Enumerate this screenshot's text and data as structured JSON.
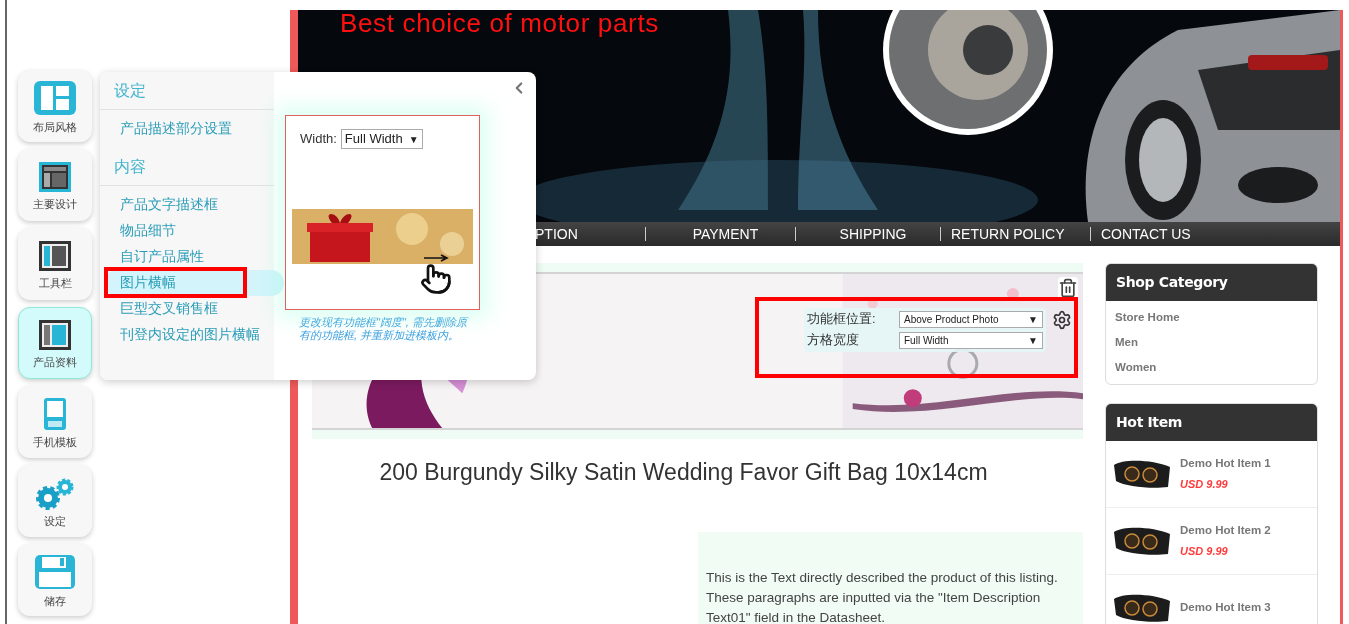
{
  "sidebar_tools": [
    {
      "kind": "layout",
      "label": "布局风格",
      "selected": false
    },
    {
      "kind": "design",
      "label": "主要设计",
      "selected": false
    },
    {
      "kind": "toolbar",
      "label": "工具栏",
      "selected": false
    },
    {
      "kind": "product",
      "label": "产品资料",
      "selected": true
    },
    {
      "kind": "mobile",
      "label": "手机模板",
      "selected": false
    },
    {
      "kind": "settings",
      "label": "设定",
      "selected": false
    },
    {
      "kind": "save",
      "label": "储存",
      "selected": false
    }
  ],
  "menu": {
    "sections": [
      {
        "heading": "设定",
        "items": [
          {
            "label": "产品描述部分设置",
            "selected": false
          }
        ]
      },
      {
        "heading": "内容",
        "items": [
          {
            "label": "产品文字描述框",
            "selected": false
          },
          {
            "label": "物品细节",
            "selected": false
          },
          {
            "label": "自订产品属性",
            "selected": false
          },
          {
            "label": "图片横幅",
            "selected": true
          },
          {
            "label": "巨型交叉销售框",
            "selected": false
          },
          {
            "label": "刊登内设定的图片横幅",
            "selected": false
          }
        ]
      }
    ]
  },
  "preview": {
    "width_label": "Width:",
    "width_value": "Full Width",
    "width_arrow": "▼",
    "note": "更改现有功能框\"阔度\", 需先删除原有的功能框, 并重新加进模板内。"
  },
  "banner": {
    "tagline": "Best choice of motor parts"
  },
  "nav": [
    "PTION",
    "PAYMENT",
    "SHIPPING",
    "RETURN POLICY",
    "CONTACT US"
  ],
  "module_settings": [
    {
      "label": "功能框位置:",
      "value": "Above Product Photo",
      "arrow": "▼"
    },
    {
      "label": "方格宽度",
      "value": "Full Width",
      "arrow": "▼"
    }
  ],
  "product": {
    "title": "200 Burgundy Silky Satin Wedding Favor Gift Bag 10x14cm",
    "description": "This is the Text directly described the product of this listing. These paragraphs are inputted via the \"Item Description Text01\" field in the Datasheet."
  },
  "shop_category": {
    "title": "Shop Category",
    "items": [
      "Store Home",
      "Men",
      "Women"
    ]
  },
  "hot_items": {
    "title": "Hot Item",
    "items": [
      {
        "name": "Demo Hot Item 1",
        "price": "USD 9.99"
      },
      {
        "name": "Demo Hot Item 2",
        "price": "USD 9.99"
      },
      {
        "name": "Demo Hot Item 3"
      }
    ]
  }
}
